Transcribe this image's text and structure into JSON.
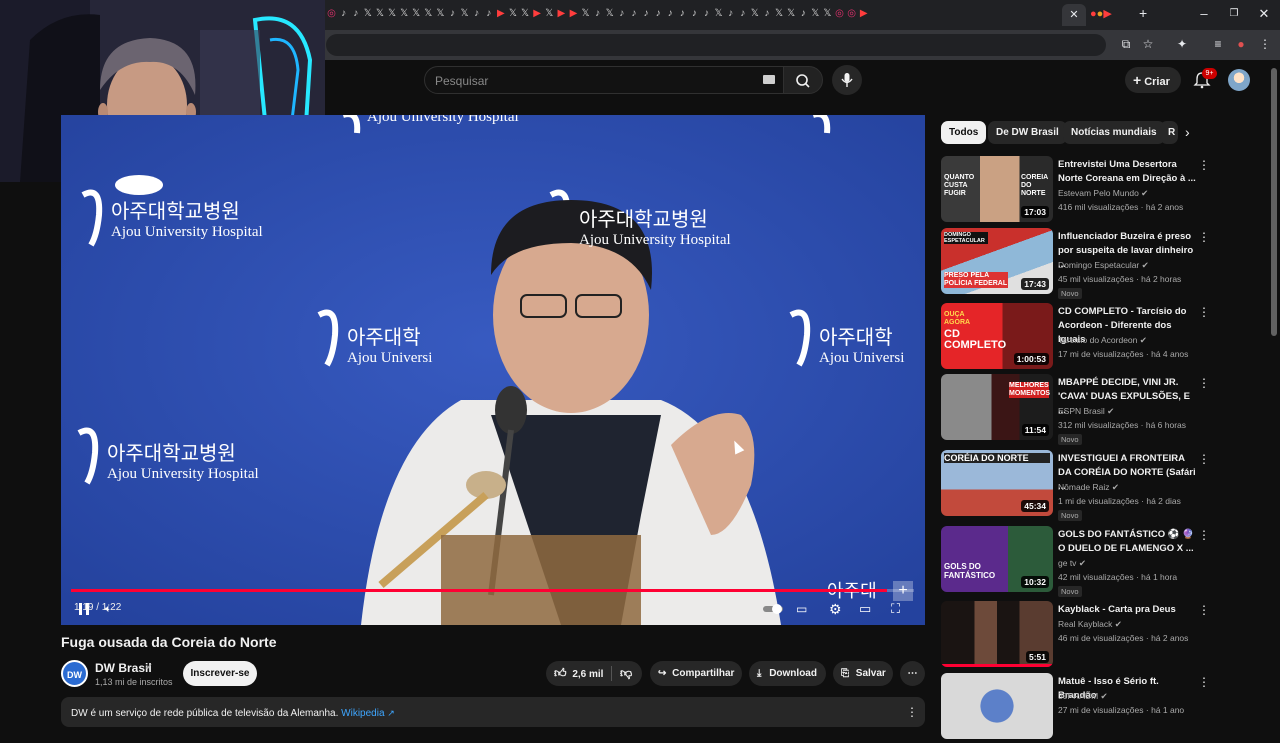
{
  "browser": {
    "tab_icons": [
      "ig",
      "tiktok",
      "tiktok",
      "x",
      "x",
      "x",
      "x",
      "x",
      "x",
      "x",
      "tiktok",
      "x",
      "tiktok",
      "tiktok",
      "yt",
      "x",
      "x",
      "yt",
      "x",
      "yt",
      "yt",
      "x",
      "tiktok",
      "x",
      "tiktok",
      "tiktok",
      "tiktok",
      "tiktok",
      "tiktok",
      "tiktok",
      "tiktok",
      "tiktok",
      "x",
      "tiktok",
      "tiktok",
      "x",
      "tiktok",
      "x",
      "x",
      "tiktok",
      "x",
      "x",
      "ig",
      "ig",
      "yt"
    ],
    "window_controls": [
      "minimize-icon",
      "maximize-icon",
      "close-icon"
    ]
  },
  "masthead": {
    "search_placeholder": "Pesquisar",
    "create_label": "Criar",
    "notifications_badge": "9+"
  },
  "video": {
    "title": "Fuga ousada da Coreia do Norte",
    "time": "1:19 / 1:22",
    "progress": 0.968,
    "backdrop_korean": "아주대학교병원",
    "backdrop_english": "Ajou University Hospital",
    "backdrop_partial_top": "Ajou University Hospital",
    "backdrop_partial_center": "Ajou Universi",
    "backdrop_partial_right_k": "아주대학",
    "backdrop_partial_right_e": "Ajou Universi",
    "backdrop_partial_bottom_right": "아주대"
  },
  "channel": {
    "avatar_text": "DW",
    "name": "DW Brasil",
    "subscribers": "1,13 mi de inscritos",
    "subscribe_label": "Inscrever-se"
  },
  "actions": {
    "likes": "2,6 mil",
    "share": "Compartilhar",
    "download": "Download",
    "save": "Salvar"
  },
  "description": {
    "text": "DW é um serviço de rede pública de televisão da Alemanha.",
    "link": "Wikipedia"
  },
  "chips": [
    "Todos",
    "De DW Brasil",
    "Notícias mundiais",
    "R"
  ],
  "recommendations": [
    {
      "title": "Entrevistei Uma Desertora Norte Coreana em Direção à ...",
      "channel": "Estevam Pelo Mundo",
      "meta": "416 mil visualizações · há 2 anos",
      "duration": "17:03",
      "new": "",
      "thumb_text": "QUANTO CUSTA FUGIR",
      "thumb_text2": "COREIA DO NORTE"
    },
    {
      "title": "Influenciador Buzeira é preso por suspeita de lavar dinheiro ...",
      "channel": "Domingo Espetacular",
      "meta": "45 mil visualizações · há 2 horas",
      "duration": "17:43",
      "new": "Novo",
      "thumb_text": "PRESO PELA POLÍCIA FEDERAL",
      "thumb_text2": "DOMINGO ESPETACULAR"
    },
    {
      "title": "CD COMPLETO - Tarcísio do Acordeon - Diferente dos Iguais",
      "channel": "Tarcísio do Acordeon",
      "meta": "17 mi de visualizações · há 4 anos",
      "duration": "1:00:53",
      "new": "",
      "thumb_text": "CD COMPLETO",
      "thumb_text2": "OUÇA AGORA"
    },
    {
      "title": "MBAPPÉ DECIDE, VINI JR. 'CAVA' DUAS EXPULSÕES, E ...",
      "channel": "ESPN Brasil",
      "meta": "312 mil visualizações · há 6 horas",
      "duration": "11:54",
      "new": "Novo",
      "thumb_text": "MELHORES MOMENTOS",
      "thumb_text2": ""
    },
    {
      "title": "INVESTIGUEI A FRONTEIRA DA CORÉIA DO NORTE (Safári ...",
      "channel": "Nômade Raiz",
      "meta": "1 mi de visualizações · há 2 dias",
      "duration": "45:34",
      "new": "Novo",
      "thumb_text": "CORÉIA DO NORTE",
      "thumb_text2": ""
    },
    {
      "title": "GOLS DO FANTÁSTICO ⚽ 🔮 O DUELO DE FLAMENGO X ...",
      "channel": "ge tv",
      "meta": "42 mil visualizações · há 1 hora",
      "duration": "10:32",
      "new": "Novo",
      "thumb_text": "GOLS DO FANTÁSTICO",
      "thumb_text2": ""
    },
    {
      "title": "Kayblack - Carta pra Deus",
      "channel": "Real Kayblack",
      "meta": "46 mi de visualizações · há 2 anos",
      "duration": "5:51",
      "new": "",
      "thumb_text": "",
      "thumb_text2": ""
    },
    {
      "title": "Matuê - Isso é Sério ft. Brandão",
      "channel": "30PRAUM",
      "meta": "27 mi de visualizações · há 1 ano",
      "duration": "",
      "new": "",
      "thumb_text": "",
      "thumb_text2": ""
    }
  ],
  "colors": {
    "background": "#0f0f0f",
    "accent_red": "#ff0033",
    "link": "#3ea6ff",
    "video_backdrop": "#2f4fb5"
  }
}
